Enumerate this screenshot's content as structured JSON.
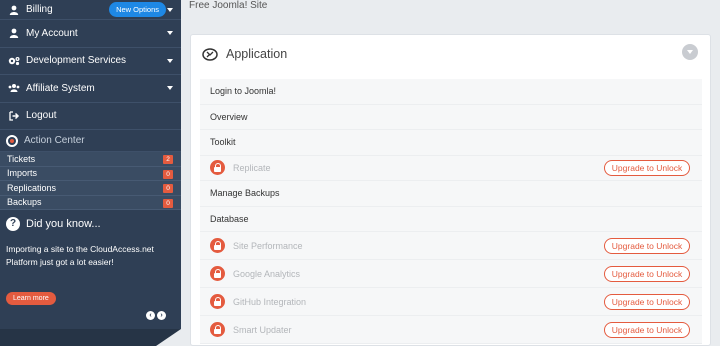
{
  "sidebar": {
    "nav": [
      {
        "label": "Billing",
        "icon": "user-icon",
        "badge": "New Options"
      },
      {
        "label": "My Account",
        "icon": "user-icon"
      },
      {
        "label": "Development Services",
        "icon": "cogs-icon"
      },
      {
        "label": "Affiliate System",
        "icon": "users-icon"
      },
      {
        "label": "Logout",
        "icon": "logout-icon"
      }
    ],
    "action_center": {
      "title": "Action Center",
      "items": [
        {
          "label": "Tickets",
          "count": "2"
        },
        {
          "label": "Imports",
          "count": "0"
        },
        {
          "label": "Replications",
          "count": "0"
        },
        {
          "label": "Backups",
          "count": "0"
        }
      ]
    },
    "did_you_know": {
      "title": "Did you know...",
      "text": "Importing a site to the CloudAccess.net Platform just got a lot easier!",
      "button": "Learn more"
    }
  },
  "main": {
    "site_title": "Free Joomla! Site",
    "card_title": "Application",
    "rows": [
      {
        "label": "Login to Joomla!",
        "locked": false
      },
      {
        "label": "Overview",
        "locked": false
      },
      {
        "label": "Toolkit",
        "locked": false
      },
      {
        "label": "Replicate",
        "locked": true,
        "action": "Upgrade to Unlock"
      },
      {
        "label": "Manage Backups",
        "locked": false
      },
      {
        "label": "Database",
        "locked": false
      },
      {
        "label": "Site Performance",
        "locked": true,
        "action": "Upgrade to Unlock"
      },
      {
        "label": "Google Analytics",
        "locked": true,
        "action": "Upgrade to Unlock"
      },
      {
        "label": "GitHub Integration",
        "locked": true,
        "action": "Upgrade to Unlock"
      },
      {
        "label": "Smart Updater",
        "locked": true,
        "action": "Upgrade to Unlock"
      }
    ]
  },
  "colors": {
    "sidebar_bg": "#2f3f55",
    "accent_orange": "#e45b3f",
    "badge_blue": "#1e88e5"
  }
}
